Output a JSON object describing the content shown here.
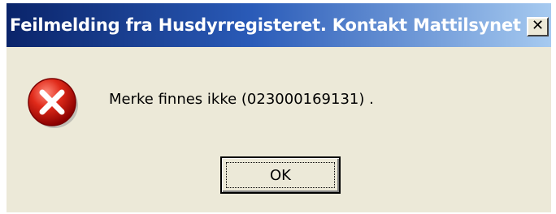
{
  "window": {
    "title": "Feilmelding fra Husdyrregisteret. Kontakt Mattilsynet",
    "close_glyph": "✕"
  },
  "icon": {
    "name": "error-icon",
    "color": "#cc0000"
  },
  "message": {
    "text": "Merke finnes ikke (023000169131) ."
  },
  "buttons": {
    "ok_label": "OK"
  },
  "colors": {
    "titlebar_start": "#0a246a",
    "titlebar_end": "#a6caf0",
    "dialog_background": "#ece9d8"
  }
}
